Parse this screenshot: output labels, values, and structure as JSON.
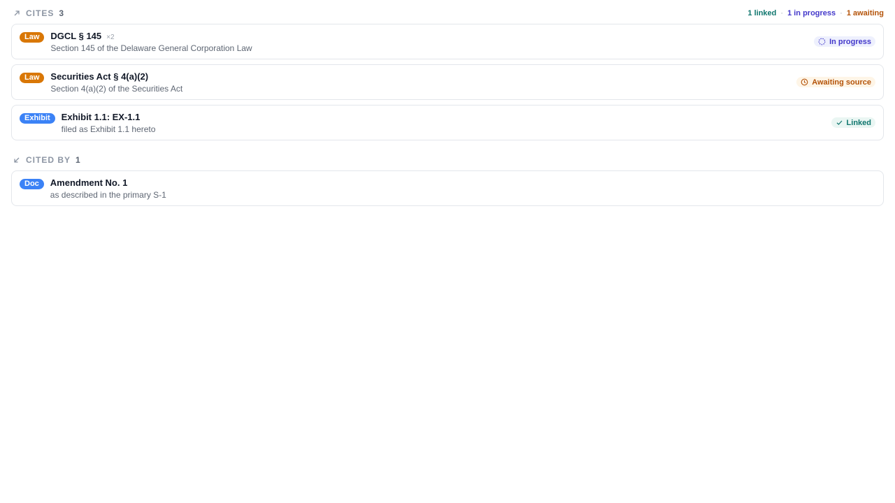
{
  "cites": {
    "title": "CITES",
    "count": "3",
    "summary": {
      "linked": "1 linked",
      "in_progress": "1 in progress",
      "awaiting": "1 awaiting",
      "separator": "·"
    },
    "items": [
      {
        "badge": "Law",
        "title": "DGCL § 145",
        "multiplier": "×2",
        "subtitle": "Section 145 of the Delaware General Corporation Law",
        "status": "In progress"
      },
      {
        "badge": "Law",
        "title": "Securities Act § 4(a)(2)",
        "subtitle": "Section 4(a)(2) of the Securities Act",
        "status": "Awaiting source"
      },
      {
        "badge": "Exhibit",
        "title": "Exhibit 1.1: EX-1.1",
        "subtitle": "filed as Exhibit 1.1 hereto",
        "status": "Linked"
      }
    ]
  },
  "cited_by": {
    "title": "CITED BY",
    "count": "1",
    "items": [
      {
        "badge": "Doc",
        "title": "Amendment No. 1",
        "subtitle": "as described in the primary S-1"
      }
    ]
  },
  "icons": {
    "cites": "arrow-up-right-icon",
    "cited_by": "arrow-down-left-icon",
    "in_progress": "loading-circle-icon",
    "awaiting": "clock-icon",
    "linked": "check-icon"
  },
  "colors": {
    "law_badge": "#d97706",
    "blue_badge": "#3b82f6",
    "linked": "#0f766e",
    "in_progress": "#4338ca",
    "awaiting": "#b45309"
  }
}
